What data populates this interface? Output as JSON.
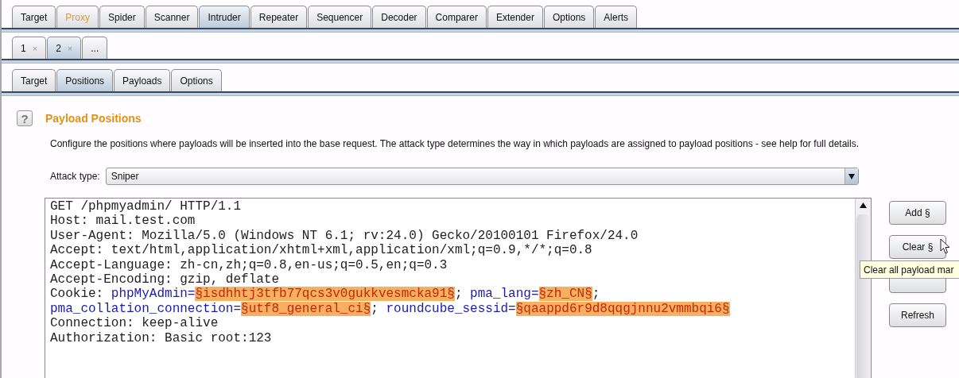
{
  "main_tabs": [
    {
      "label": "Target",
      "selected": false,
      "highlighted": false
    },
    {
      "label": "Proxy",
      "selected": false,
      "highlighted": true
    },
    {
      "label": "Spider",
      "selected": false,
      "highlighted": false
    },
    {
      "label": "Scanner",
      "selected": false,
      "highlighted": false
    },
    {
      "label": "Intruder",
      "selected": true,
      "highlighted": false
    },
    {
      "label": "Repeater",
      "selected": false,
      "highlighted": false
    },
    {
      "label": "Sequencer",
      "selected": false,
      "highlighted": false
    },
    {
      "label": "Decoder",
      "selected": false,
      "highlighted": false
    },
    {
      "label": "Comparer",
      "selected": false,
      "highlighted": false
    },
    {
      "label": "Extender",
      "selected": false,
      "highlighted": false
    },
    {
      "label": "Options",
      "selected": false,
      "highlighted": false
    },
    {
      "label": "Alerts",
      "selected": false,
      "highlighted": false
    }
  ],
  "attack_tabs": [
    {
      "label": "1",
      "close": "×",
      "selected": false
    },
    {
      "label": "2",
      "close": "×",
      "selected": true
    },
    {
      "label": "...",
      "selected": false
    }
  ],
  "sub_tabs": [
    {
      "label": "Target",
      "selected": false
    },
    {
      "label": "Positions",
      "selected": true
    },
    {
      "label": "Payloads",
      "selected": false
    },
    {
      "label": "Options",
      "selected": false
    }
  ],
  "section": {
    "help": "?",
    "title": "Payload Positions",
    "description": "Configure the positions where payloads will be inserted into the base request. The attack type determines the way in which payloads are assigned to payload positions - see help for full details."
  },
  "attack_type": {
    "label": "Attack type:",
    "value": "Sniper"
  },
  "request": {
    "lines": [
      [
        {
          "kind": "plain",
          "text": "GET /phpmyadmin/ HTTP/1.1"
        }
      ],
      [
        {
          "kind": "plain",
          "text": "Host: mail.test.com"
        }
      ],
      [
        {
          "kind": "plain",
          "text": "User-Agent: Mozilla/5.0 (Windows NT 6.1; rv:24.0) Gecko/20100101 Firefox/24.0"
        }
      ],
      [
        {
          "kind": "plain",
          "text": "Accept: text/html,application/xhtml+xml,application/xml;q=0.9,*/*;q=0.8"
        }
      ],
      [
        {
          "kind": "plain",
          "text": "Accept-Language: zh-cn,zh;q=0.8,en-us;q=0.5,en;q=0.3"
        }
      ],
      [
        {
          "kind": "plain",
          "text": "Accept-Encoding: gzip, deflate"
        }
      ],
      [
        {
          "kind": "plain",
          "text": "Cookie: "
        },
        {
          "kind": "param",
          "text": "phpMyAdmin="
        },
        {
          "kind": "marker",
          "text": "§isdhhtj3tfb77qcs3v0gukkvesmcka91§"
        },
        {
          "kind": "plain",
          "text": "; "
        },
        {
          "kind": "param",
          "text": "pma_lang="
        },
        {
          "kind": "marker",
          "text": "§zh_CN§"
        },
        {
          "kind": "plain",
          "text": ";"
        }
      ],
      [
        {
          "kind": "param",
          "text": "pma_collation_connection="
        },
        {
          "kind": "marker",
          "text": "§utf8_general_ci§"
        },
        {
          "kind": "plain",
          "text": "; "
        },
        {
          "kind": "param",
          "text": "roundcube_sessid="
        },
        {
          "kind": "marker",
          "text": "§qaappd6r9d8qqgjnnu2vmmbqi6§"
        }
      ],
      [
        {
          "kind": "plain",
          "text": "Connection: keep-alive"
        }
      ],
      [
        {
          "kind": "plain",
          "text": "Authorization: Basic root:123"
        }
      ]
    ]
  },
  "buttons": [
    {
      "label": "Add §",
      "kind": "button"
    },
    {
      "label": "Clear §",
      "kind": "button"
    },
    {
      "kind": "covered"
    },
    {
      "label": "Refresh",
      "kind": "button"
    }
  ],
  "tooltip": "Clear all payload mar"
}
